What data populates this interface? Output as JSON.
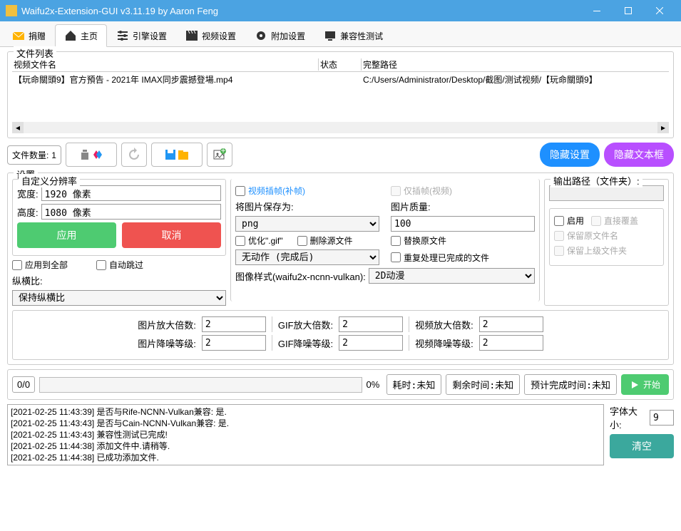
{
  "window": {
    "title": "Waifu2x-Extension-GUI v3.11.19 by Aaron Feng"
  },
  "tabs": {
    "donate": "捐赠",
    "home": "主页",
    "engine": "引擎设置",
    "video": "视频设置",
    "addon": "附加设置",
    "compat": "兼容性测试"
  },
  "filelist": {
    "title": "文件列表",
    "cols": {
      "name": "视频文件名",
      "status": "状态",
      "path": "完整路径"
    },
    "rows": [
      {
        "name": "【玩命關頭9】官方預告 - 2021年 IMAX同步震撼登場.mp4",
        "status": "",
        "path": "C:/Users/Administrator/Desktop/截图/测试视频/【玩命關頭9】"
      }
    ]
  },
  "toolbar": {
    "filecount_label": "文件数量:",
    "filecount_value": "1",
    "hide_settings": "隐藏设置",
    "hide_textbox": "隐藏文本框"
  },
  "settings": {
    "title": "设置",
    "resolution": {
      "title": "自定义分辨率",
      "width_label": "宽度:",
      "width_value": "1920 像素",
      "height_label": "高度:",
      "height_value": "1080 像素",
      "apply": "应用",
      "cancel": "取消",
      "apply_all": "应用到全部",
      "auto_skip": "自动跳过",
      "aspect_label": "纵横比:",
      "aspect_value": "保持纵横比"
    },
    "mid": {
      "interp": "视频插帧(补帧)",
      "interp_only": "仅插帧(视频)",
      "save_as_label": "将图片保存为:",
      "save_as_value": "png",
      "quality_label": "图片质量:",
      "quality_value": "100",
      "opt_gif": "优化\".gif\"",
      "del_src": "删除源文件",
      "replace_src": "替换原文件",
      "after_action": "无动作 (完成后)",
      "reprocess": "重复处理已完成的文件",
      "style_label": "图像样式(waifu2x-ncnn-vulkan):",
      "style_value": "2D动漫"
    },
    "output": {
      "title": "输出路径（文件夹）:",
      "enable": "启用",
      "overwrite": "直接覆盖",
      "keep_name": "保留原文件名",
      "keep_parent": "保留上级文件夹"
    }
  },
  "scale": {
    "img_scale": "图片放大倍数:",
    "gif_scale": "GIF放大倍数:",
    "vid_scale": "视频放大倍数:",
    "img_denoise": "图片降噪等级:",
    "gif_denoise": "GIF降噪等级:",
    "vid_denoise": "视频降噪等级:",
    "val_img_scale": "2",
    "val_gif_scale": "2",
    "val_vid_scale": "2",
    "val_img_denoise": "2",
    "val_gif_denoise": "2",
    "val_vid_denoise": "2"
  },
  "progress": {
    "count": "0/0",
    "pct": "0%",
    "elapsed": "耗时:未知",
    "remaining": "剩余时间:未知",
    "eta": "预计完成时间:未知",
    "start": "开始"
  },
  "log": {
    "lines": [
      "[2021-02-25 11:43:39] 是否与Rife-NCNN-Vulkan兼容: 是.",
      "[2021-02-25 11:43:43] 是否与Cain-NCNN-Vulkan兼容: 是.",
      "[2021-02-25 11:43:43] 兼容性测试已完成!",
      "[2021-02-25 11:44:38] 添加文件中.请稍等.",
      "[2021-02-25 11:44:38] 已成功添加文件."
    ],
    "font_label": "字体大小:",
    "font_value": "9",
    "clear": "清空"
  }
}
